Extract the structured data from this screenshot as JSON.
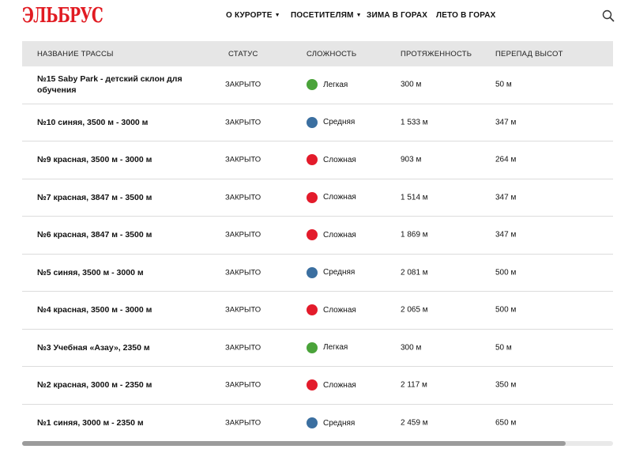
{
  "header": {
    "logo": "ЭЛЬБРУС",
    "nav": [
      {
        "label": "О КУРОРТЕ",
        "caret": true
      },
      {
        "label": "ПОСЕТИТЕЛЯМ",
        "caret": true
      },
      {
        "label": "ЗИМА В ГОРАХ",
        "caret": false
      },
      {
        "label": "ЛЕТО В ГОРАХ",
        "caret": false
      }
    ],
    "search_icon": "search-icon"
  },
  "table": {
    "columns": [
      "НАЗВАНИЕ ТРАССЫ",
      "СТАТУС",
      "СЛОЖНОСТЬ",
      "ПРОТЯЖЕННОСТЬ",
      "ПЕРЕПАД ВЫСОТ"
    ],
    "rows": [
      {
        "name": "№15 Saby Park - детский склон для обучения",
        "status": "ЗАКРЫТО",
        "difficulty": "Легкая",
        "color": "#4aa33a",
        "length": "300 м",
        "drop": "50 м"
      },
      {
        "name": "№10 синяя, 3500 м - 3000 м",
        "status": "ЗАКРЫТО",
        "difficulty": "Средняя",
        "color": "#3b6fa0",
        "length": "1 533 м",
        "drop": "347 м"
      },
      {
        "name": "№9 красная, 3500 м - 3000 м",
        "status": "ЗАКРЫТО",
        "difficulty": "Сложная",
        "color": "#e31b2b",
        "length": "903 м",
        "drop": "264 м"
      },
      {
        "name": "№7 красная, 3847 м - 3500 м",
        "status": "ЗАКРЫТО",
        "difficulty": "Сложная",
        "color": "#e31b2b",
        "length": "1 514 м",
        "drop": "347 м"
      },
      {
        "name": "№6 красная, 3847 м - 3500 м",
        "status": "ЗАКРЫТО",
        "difficulty": "Сложная",
        "color": "#e31b2b",
        "length": "1 869 м",
        "drop": "347 м"
      },
      {
        "name": "№5 синяя, 3500 м - 3000 м",
        "status": "ЗАКРЫТО",
        "difficulty": "Средняя",
        "color": "#3b6fa0",
        "length": "2 081 м",
        "drop": "500 м"
      },
      {
        "name": "№4 красная, 3500 м - 3000 м",
        "status": "ЗАКРЫТО",
        "difficulty": "Сложная",
        "color": "#e31b2b",
        "length": "2 065 м",
        "drop": "500 м"
      },
      {
        "name": "№3 Учебная «Азау», 2350 м",
        "status": "ЗАКРЫТО",
        "difficulty": "Легкая",
        "color": "#4aa33a",
        "length": "300 м",
        "drop": "50 м"
      },
      {
        "name": "№2 красная, 3000 м - 2350 м",
        "status": "ЗАКРЫТО",
        "difficulty": "Сложная",
        "color": "#e31b2b",
        "length": "2 117 м",
        "drop": "350 м"
      },
      {
        "name": "№1 синяя, 3000 м - 2350 м",
        "status": "ЗАКРЫТО",
        "difficulty": "Средняя",
        "color": "#3b6fa0",
        "length": "2 459 м",
        "drop": "650 м"
      }
    ]
  },
  "scrollbar": {
    "position": 0.0,
    "visible_fraction": 0.92
  }
}
